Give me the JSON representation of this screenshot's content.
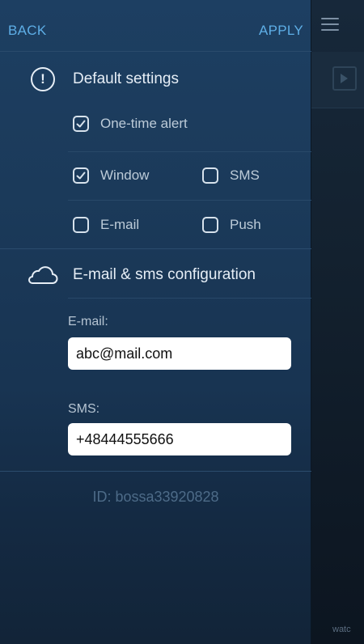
{
  "topbar": {
    "back_label": "BACK",
    "apply_label": "APPLY"
  },
  "default_settings": {
    "title": "Default settings",
    "icon": "exclamation-circle-icon",
    "options": [
      {
        "label": "One-time alert",
        "checked": true
      },
      {
        "label": "Window",
        "checked": true
      },
      {
        "label": "SMS",
        "checked": false
      },
      {
        "label": "E-mail",
        "checked": false
      },
      {
        "label": "Push",
        "checked": false
      }
    ]
  },
  "config": {
    "title": "E-mail & sms configuration",
    "icon": "cloud-icon",
    "email_label": "E-mail:",
    "email_value": "abc@mail.com",
    "sms_label": "SMS:",
    "sms_value": "+48444555666"
  },
  "id_text": "ID: bossa33920828",
  "background_app": {
    "label": "watc",
    "menu_icon": "hamburger-menu-icon",
    "video_icon": "film-icon"
  },
  "colors": {
    "accent": "#5eaee6",
    "panel": "#1b3a5a"
  }
}
